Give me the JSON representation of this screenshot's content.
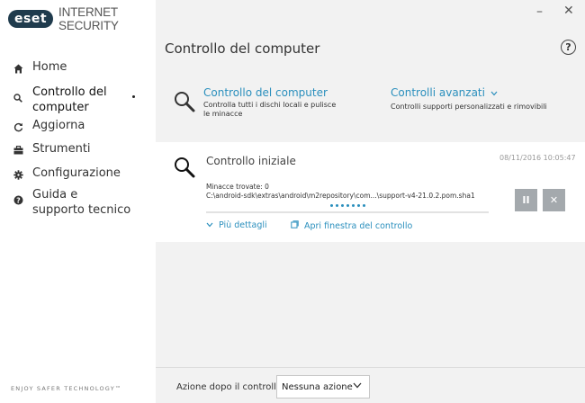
{
  "app": {
    "logo_text": "eset",
    "product": "INTERNET SECURITY",
    "tagline": "ENJOY SAFER TECHNOLOGY™"
  },
  "window": {
    "minimize": "–",
    "close": "✕"
  },
  "sidebar": {
    "items": [
      {
        "label": "Home",
        "icon": "home-icon"
      },
      {
        "label": "Controllo del computer",
        "icon": "search-icon",
        "active": true
      },
      {
        "label": "Aggiorna",
        "icon": "refresh-icon"
      },
      {
        "label": "Strumenti",
        "icon": "toolbox-icon"
      },
      {
        "label": "Configurazione",
        "icon": "gear-icon"
      },
      {
        "label": "Guida e supporto tecnico",
        "icon": "help-icon"
      }
    ]
  },
  "main": {
    "title": "Controllo del computer",
    "help": "?",
    "options": {
      "computer_scan": {
        "label": "Controllo del computer",
        "description": "Controlla tutti i dischi locali e pulisce le minacce"
      },
      "advanced": {
        "label": "Controlli avanzati",
        "description": "Controlli supporti personalizzati e rimovibili"
      }
    },
    "scan": {
      "title": "Controllo iniziale",
      "timestamp": "08/11/2016 10:05:47",
      "threats": "Minacce trovate: 0",
      "path": "C:\\android-sdk\\extras\\android\\m2repository\\com...\\support-v4-21.0.2.pom.sha1",
      "more_details": "Più dettagli",
      "open_window": "Apri finestra del controllo",
      "pause": "II",
      "stop": "✕"
    },
    "after_scan": {
      "label": "Azione dopo il controllo",
      "value": "Nessuna azione"
    }
  },
  "colors": {
    "accent": "#2a8fbd",
    "brand_dark": "#1f3b4d",
    "button_gray": "#a4a9ad"
  }
}
